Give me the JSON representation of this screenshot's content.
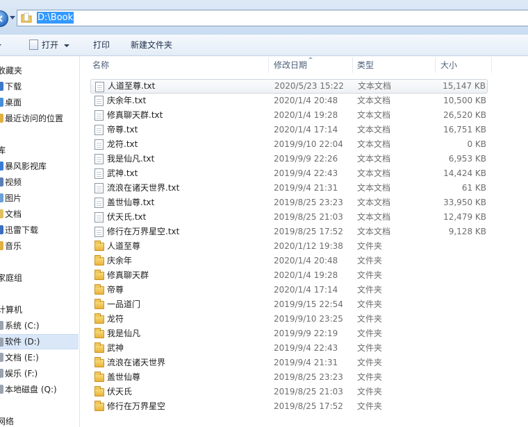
{
  "address_bar": {
    "path": "D:\\Book"
  },
  "toolbar": {
    "open_label": "打开",
    "print_label": "打印",
    "new_folder_label": "新建文件夹"
  },
  "sidebar": {
    "items": [
      {
        "label": "收藏夹",
        "kind": "header",
        "icon": "star-icon"
      },
      {
        "label": "下载",
        "kind": "item",
        "icon": "download-folder-icon",
        "color": "#3d78c8"
      },
      {
        "label": "桌面",
        "kind": "item",
        "icon": "desktop-icon",
        "color": "#4a8fd8"
      },
      {
        "label": "最近访问的位置",
        "kind": "item",
        "icon": "recent-places-icon",
        "color": "#e0b040"
      },
      {
        "label": "库",
        "kind": "header",
        "icon": "library-icon"
      },
      {
        "label": "暴风影视库",
        "kind": "item",
        "icon": "video-library-icon",
        "color": "#3b7bd6"
      },
      {
        "label": "视频",
        "kind": "item",
        "icon": "video-icon",
        "color": "#5a7fb5"
      },
      {
        "label": "图片",
        "kind": "item",
        "icon": "pictures-icon",
        "color": "#6aa0d8"
      },
      {
        "label": "文档",
        "kind": "item",
        "icon": "documents-icon",
        "color": "#e2c060"
      },
      {
        "label": "迅雷下载",
        "kind": "item",
        "icon": "thunder-download-icon",
        "color": "#3a6fc0"
      },
      {
        "label": "音乐",
        "kind": "item",
        "icon": "music-icon",
        "color": "#e0b040"
      },
      {
        "label": "家庭组",
        "kind": "header",
        "icon": "homegroup-icon"
      },
      {
        "label": "计算机",
        "kind": "header",
        "icon": "computer-icon"
      },
      {
        "label": "系统 (C:)",
        "kind": "item",
        "icon": "drive-icon",
        "color": "#9aa4b0"
      },
      {
        "label": "软件 (D:)",
        "kind": "item",
        "icon": "drive-icon",
        "color": "#9aa4b0",
        "selected": true
      },
      {
        "label": "文档 (E:)",
        "kind": "item",
        "icon": "drive-icon",
        "color": "#9aa4b0"
      },
      {
        "label": "娱乐 (F:)",
        "kind": "item",
        "icon": "drive-icon",
        "color": "#9aa4b0"
      },
      {
        "label": "本地磁盘 (Q:)",
        "kind": "item",
        "icon": "drive-icon",
        "color": "#9aa4b0"
      },
      {
        "label": "网络",
        "kind": "header",
        "icon": "network-icon"
      }
    ]
  },
  "columns": {
    "name": "名称",
    "date_modified": "修改日期",
    "type": "类型",
    "size": "大小"
  },
  "files": [
    {
      "name": "人道至尊.txt",
      "date": "2020/5/23 15:22",
      "type": "文本文档",
      "size": "15,147 KB",
      "kind": "txt",
      "selected": true
    },
    {
      "name": "庆余年.txt",
      "date": "2020/1/4 20:48",
      "type": "文本文档",
      "size": "10,500 KB",
      "kind": "txt"
    },
    {
      "name": "修真聊天群.txt",
      "date": "2020/1/4 19:28",
      "type": "文本文档",
      "size": "26,520 KB",
      "kind": "txt"
    },
    {
      "name": "帝尊.txt",
      "date": "2020/1/4 17:14",
      "type": "文本文档",
      "size": "16,751 KB",
      "kind": "txt"
    },
    {
      "name": "龙符.txt",
      "date": "2019/9/10 22:04",
      "type": "文本文档",
      "size": "0 KB",
      "kind": "txt"
    },
    {
      "name": "我是仙凡.txt",
      "date": "2019/9/9 22:26",
      "type": "文本文档",
      "size": "6,953 KB",
      "kind": "txt"
    },
    {
      "name": "武神.txt",
      "date": "2019/9/4 22:43",
      "type": "文本文档",
      "size": "14,424 KB",
      "kind": "txt"
    },
    {
      "name": "流浪在诸天世界.txt",
      "date": "2019/9/4 21:31",
      "type": "文本文档",
      "size": "61 KB",
      "kind": "txt"
    },
    {
      "name": "盖世仙尊.txt",
      "date": "2019/8/25 23:23",
      "type": "文本文档",
      "size": "33,950 KB",
      "kind": "txt"
    },
    {
      "name": "伏天氏.txt",
      "date": "2019/8/25 21:03",
      "type": "文本文档",
      "size": "12,479 KB",
      "kind": "txt"
    },
    {
      "name": "修行在万界星空.txt",
      "date": "2019/8/25 17:52",
      "type": "文本文档",
      "size": "9,128 KB",
      "kind": "txt"
    },
    {
      "name": "人道至尊",
      "date": "2020/1/12 19:38",
      "type": "文件夹",
      "size": "",
      "kind": "folder"
    },
    {
      "name": "庆余年",
      "date": "2020/1/4 20:48",
      "type": "文件夹",
      "size": "",
      "kind": "folder"
    },
    {
      "name": "修真聊天群",
      "date": "2020/1/4 19:28",
      "type": "文件夹",
      "size": "",
      "kind": "folder"
    },
    {
      "name": "帝尊",
      "date": "2020/1/4 17:14",
      "type": "文件夹",
      "size": "",
      "kind": "folder"
    },
    {
      "name": "一品道门",
      "date": "2019/9/15 22:54",
      "type": "文件夹",
      "size": "",
      "kind": "folder"
    },
    {
      "name": "龙符",
      "date": "2019/9/10 23:25",
      "type": "文件夹",
      "size": "",
      "kind": "folder"
    },
    {
      "name": "我是仙凡",
      "date": "2019/9/9 22:19",
      "type": "文件夹",
      "size": "",
      "kind": "folder"
    },
    {
      "name": "武神",
      "date": "2019/9/4 22:43",
      "type": "文件夹",
      "size": "",
      "kind": "folder"
    },
    {
      "name": "流浪在诸天世界",
      "date": "2019/9/4 21:31",
      "type": "文件夹",
      "size": "",
      "kind": "folder"
    },
    {
      "name": "盖世仙尊",
      "date": "2019/8/25 23:23",
      "type": "文件夹",
      "size": "",
      "kind": "folder"
    },
    {
      "name": "伏天氏",
      "date": "2019/8/25 21:03",
      "type": "文件夹",
      "size": "",
      "kind": "folder"
    },
    {
      "name": "修行在万界星空",
      "date": "2019/8/25 17:52",
      "type": "文件夹",
      "size": "",
      "kind": "folder"
    }
  ]
}
